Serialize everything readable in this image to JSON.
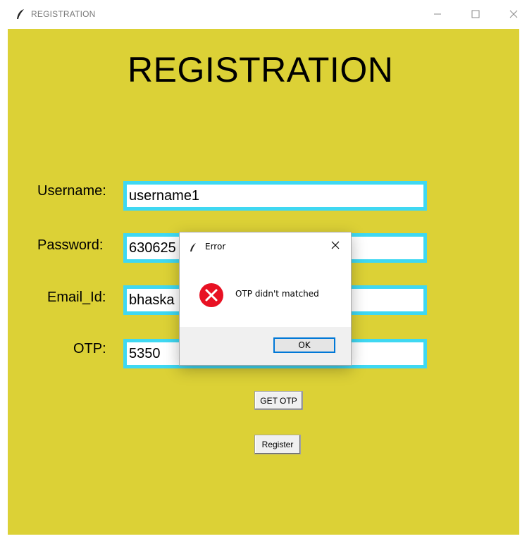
{
  "window": {
    "title": "REGISTRATION",
    "icon": "feather-icon"
  },
  "form": {
    "heading": "REGISTRATION",
    "fields": [
      {
        "label": "Username:",
        "value": "username1"
      },
      {
        "label": "Password:",
        "value": "630625"
      },
      {
        "label": "Email_Id:",
        "value": "bhaska"
      },
      {
        "label": "OTP:",
        "value": "5350"
      }
    ],
    "get_otp_label": "GET OTP",
    "register_label": "Register"
  },
  "dialog": {
    "title": "Error",
    "message": "OTP didn't matched",
    "ok_label": "OK",
    "icon": "error-icon"
  },
  "colors": {
    "background": "#dcd136",
    "entry_border": "#3fd8f2",
    "error_red": "#e81123",
    "focus_blue": "#0078d7"
  }
}
